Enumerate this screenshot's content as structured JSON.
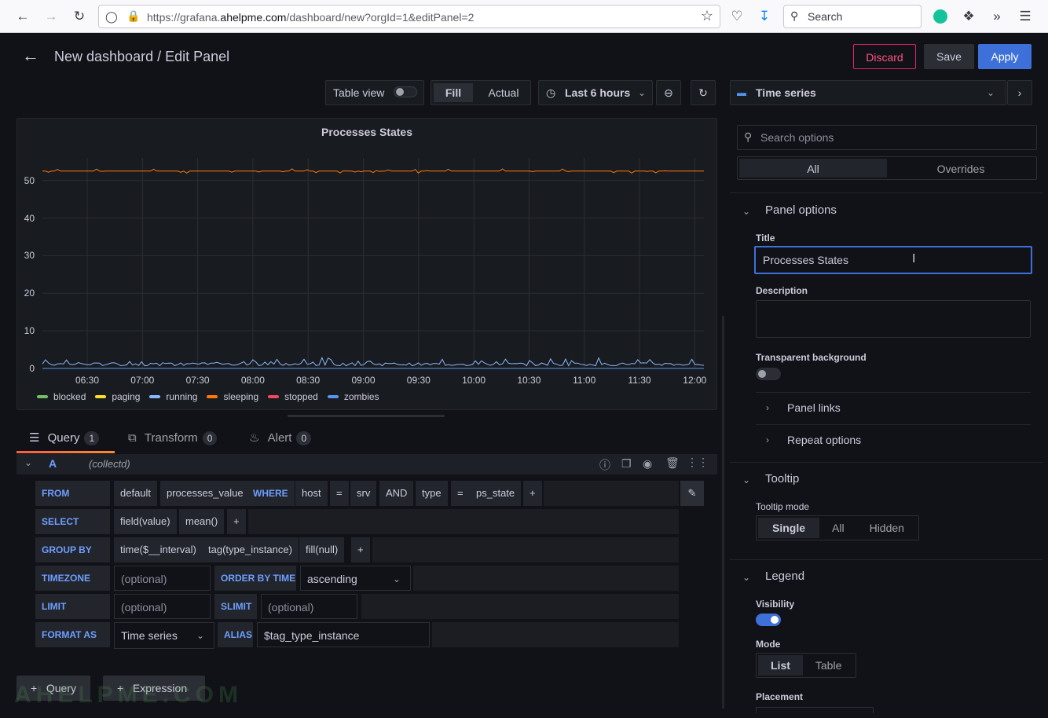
{
  "browser": {
    "url_prefix": "https://grafana.",
    "url_domain": "ahelpme.com",
    "url_suffix": "/dashboard/new?orgId=1&editPanel=2",
    "search_placeholder": "Search"
  },
  "header": {
    "title": "New dashboard / Edit Panel",
    "discard_label": "Discard",
    "save_label": "Save",
    "apply_label": "Apply"
  },
  "toolbar": {
    "table_view_label": "Table view",
    "fill_label": "Fill",
    "actual_label": "Actual",
    "time_range_label": "Last 6 hours",
    "visualization_label": "Time series"
  },
  "panel": {
    "title": "Processes States"
  },
  "chart_data": {
    "type": "line",
    "title": "Processes States",
    "xlabel": "",
    "ylabel": "",
    "ylim": [
      0,
      56
    ],
    "x_ticks": [
      "06:30",
      "07:00",
      "07:30",
      "08:00",
      "08:30",
      "09:00",
      "09:30",
      "10:00",
      "10:30",
      "11:00",
      "11:30",
      "12:00"
    ],
    "y_ticks": [
      "0",
      "10",
      "20",
      "30",
      "40",
      "50"
    ],
    "grid": true,
    "legend_position": "bottom-left",
    "series": [
      {
        "name": "blocked",
        "color": "#73bf69",
        "level": 0
      },
      {
        "name": "paging",
        "color": "#fade2a",
        "level": 0
      },
      {
        "name": "running",
        "color": "#8ab8ff",
        "level": 1
      },
      {
        "name": "sleeping",
        "color": "#ff780a",
        "level": 52.5
      },
      {
        "name": "stopped",
        "color": "#f2495c",
        "level": 0
      },
      {
        "name": "zombies",
        "color": "#5794f2",
        "level": 0
      }
    ]
  },
  "tabs": [
    {
      "label": "Query",
      "count": "1"
    },
    {
      "label": "Transform",
      "count": "0"
    },
    {
      "label": "Alert",
      "count": "0"
    }
  ],
  "query": {
    "ref_id": "A",
    "datasource": "(collectd)",
    "from_kw": "FROM",
    "from_policy": "default",
    "from_measurement": "processes_value",
    "where_kw": "WHERE",
    "where_key1": "host",
    "where_op1": "=",
    "where_val1": "srv",
    "where_and": "AND",
    "where_key2": "type",
    "where_op2": "=",
    "where_val2": "ps_state",
    "plus": "+",
    "select_kw": "SELECT",
    "select_field": "field(value)",
    "select_agg": "mean()",
    "groupby_kw": "GROUP BY",
    "groupby_time": "time($__interval)",
    "groupby_tag": "tag(type_instance)",
    "groupby_fill": "fill(null)",
    "timezone_kw": "TIMEZONE",
    "optional": "(optional)",
    "orderby_kw": "ORDER BY TIME",
    "orderby_value": "ascending",
    "limit_kw": "LIMIT",
    "slimit_kw": "SLIMIT",
    "formatas_kw": "FORMAT AS",
    "formatas_value": "Time series",
    "alias_kw": "ALIAS",
    "alias_value": "$tag_type_instance",
    "add_query_label": "Query",
    "add_expression_label": "Expression"
  },
  "options": {
    "search_placeholder": "Search options",
    "all_label": "All",
    "overrides_label": "Overrides",
    "panel_options_label": "Panel options",
    "title_label": "Title",
    "title_value": "Processes States",
    "description_label": "Description",
    "transparent_label": "Transparent background",
    "panel_links_label": "Panel links",
    "repeat_options_label": "Repeat options",
    "tooltip_label": "Tooltip",
    "tooltip_mode_label": "Tooltip mode",
    "tooltip_single": "Single",
    "tooltip_all": "All",
    "tooltip_hidden": "Hidden",
    "legend_label": "Legend",
    "visibility_label": "Visibility",
    "mode_label": "Mode",
    "mode_list": "List",
    "mode_table": "Table",
    "placement_label": "Placement"
  },
  "watermark": "AHELPME.COM"
}
